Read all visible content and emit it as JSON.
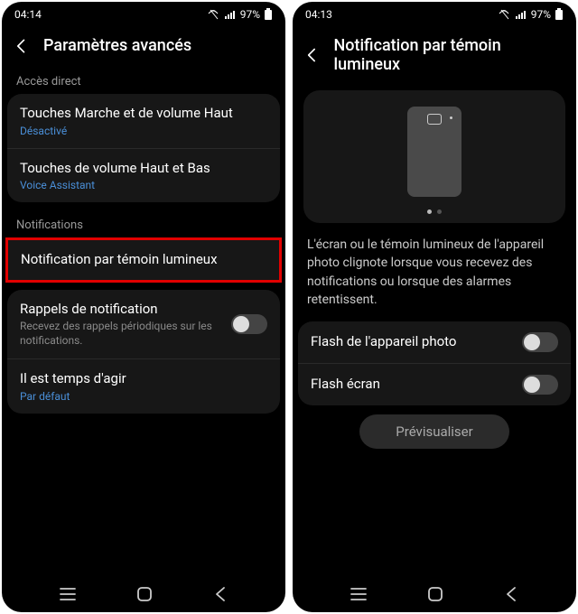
{
  "left": {
    "status": {
      "time": "04:14",
      "battery": "97%"
    },
    "header_title": "Paramètres avancés",
    "section1_label": "Accès direct",
    "item_power_vol_up": {
      "title": "Touches Marche et de volume Haut",
      "sub": "Désactivé"
    },
    "item_vol_updown": {
      "title": "Touches de volume Haut et Bas",
      "sub": "Voice Assistant"
    },
    "section2_label": "Notifications",
    "item_flash": {
      "title": "Notification par témoin lumineux"
    },
    "item_reminder": {
      "title": "Rappels de notification",
      "sub": "Recevez des rappels périodiques sur les notifications."
    },
    "item_action": {
      "title": "Il est temps d'agir",
      "sub": "Par défaut"
    }
  },
  "right": {
    "status": {
      "time": "04:13",
      "battery": "97%"
    },
    "header_title": "Notification par témoin lumineux",
    "description": "L'écran ou le témoin lumineux de l'appareil photo clignote lorsque vous recevez des notifications ou lorsque des alarmes retentissent.",
    "toggle_camera": "Flash de l'appareil photo",
    "toggle_screen": "Flash écran",
    "preview_button": "Prévisualiser"
  }
}
